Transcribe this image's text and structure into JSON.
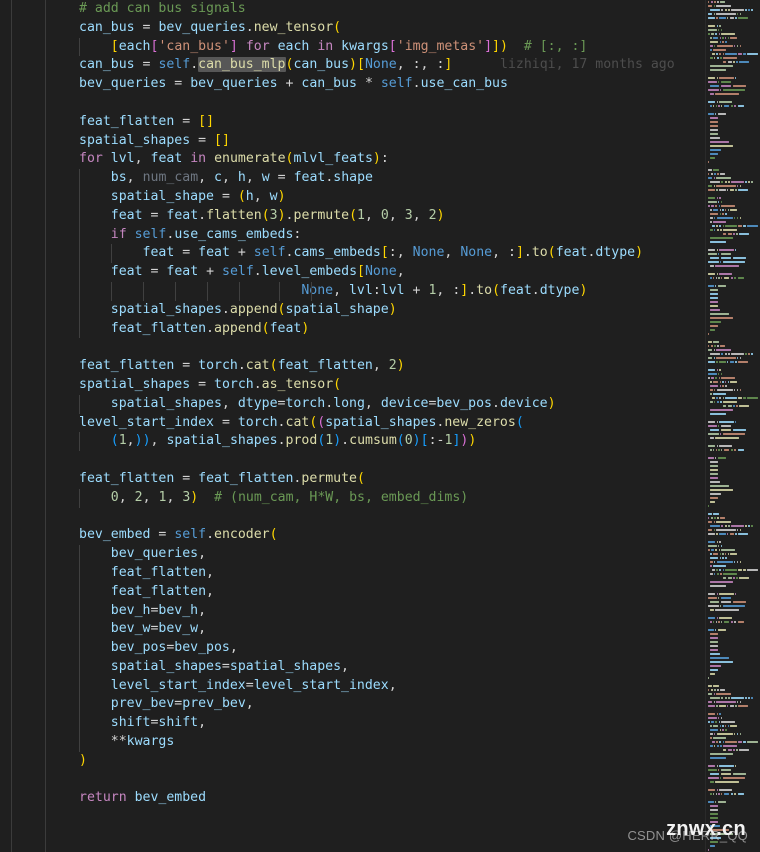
{
  "app": {
    "kind": "code-editor",
    "theme": "dark-modern",
    "background": "#1f1f1f",
    "foreground": "#cccccc"
  },
  "colors": {
    "comment": "#6a9955",
    "variable": "#9cdcfe",
    "function": "#dcdcaa",
    "keyword": "#c586c0",
    "control": "#569cd6",
    "string": "#ce9178",
    "number": "#b5cea8",
    "operator": "#d4d4d4",
    "bracket_level_0": "#ffd700",
    "bracket_level_1": "#da70d6",
    "bracket_level_2": "#179fff",
    "dimmed": "#6e7681",
    "selection_highlight": "#575757",
    "indent_guide": "#404040",
    "blame_text": "#4d4d4d"
  },
  "blame": {
    "author": "lizhiqi",
    "age": "17 months ago",
    "text": "lizhiqi, 17 months ago"
  },
  "selection": {
    "highlighted_word": "can_bus_mlp"
  },
  "watermarks": {
    "site": "znwx.cn",
    "csdn": "CSDN @HERR_QQ"
  },
  "code": {
    "language": "python",
    "lines": [
      "# add can bus signals",
      "can_bus = bev_queries.new_tensor(",
      "    [each['can_bus'] for each in kwargs['img_metas']])  # [:, :]",
      "can_bus = self.can_bus_mlp(can_bus)[None, :, :]",
      "bev_queries = bev_queries + can_bus * self.use_can_bus",
      "",
      "feat_flatten = []",
      "spatial_shapes = []",
      "for lvl, feat in enumerate(mlvl_feats):",
      "    bs, num_cam, c, h, w = feat.shape",
      "    spatial_shape = (h, w)",
      "    feat = feat.flatten(3).permute(1, 0, 3, 2)",
      "    if self.use_cams_embeds:",
      "        feat = feat + self.cams_embeds[:, None, None, :].to(feat.dtype)",
      "    feat = feat + self.level_embeds[None,",
      "                            None, lvl:lvl + 1, :].to(feat.dtype)",
      "    spatial_shapes.append(spatial_shape)",
      "    feat_flatten.append(feat)",
      "",
      "feat_flatten = torch.cat(feat_flatten, 2)",
      "spatial_shapes = torch.as_tensor(",
      "    spatial_shapes, dtype=torch.long, device=bev_pos.device)",
      "level_start_index = torch.cat((spatial_shapes.new_zeros(",
      "    (1,)), spatial_shapes.prod(1).cumsum(0)[:-1]))",
      "",
      "feat_flatten = feat_flatten.permute(",
      "    0, 2, 1, 3)  # (num_cam, H*W, bs, embed_dims)",
      "",
      "bev_embed = self.encoder(",
      "    bev_queries,",
      "    feat_flatten,",
      "    feat_flatten,",
      "    bev_h=bev_h,",
      "    bev_w=bev_w,",
      "    bev_pos=bev_pos,",
      "    spatial_shapes=spatial_shapes,",
      "    level_start_index=level_start_index,",
      "    prev_bev=prev_bev,",
      "    shift=shift,",
      "    **kwargs",
      ")",
      "",
      "return bev_embed"
    ]
  }
}
